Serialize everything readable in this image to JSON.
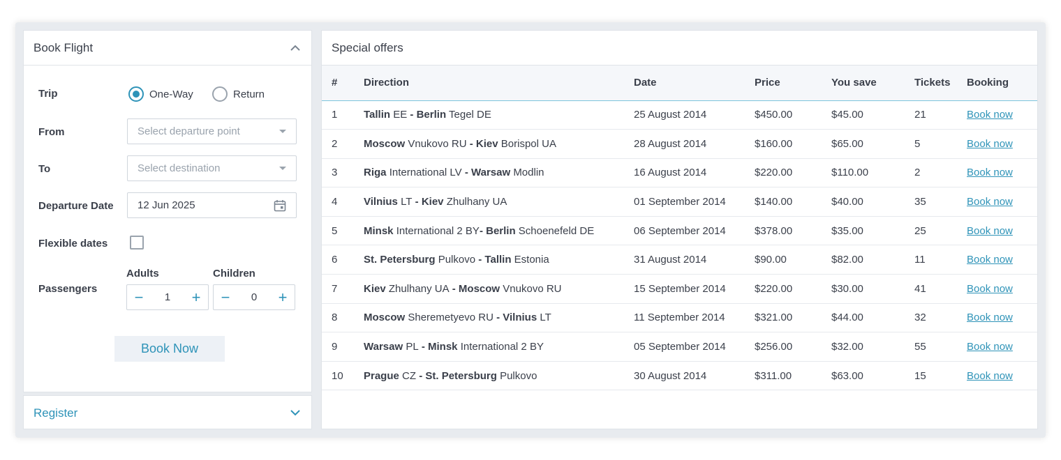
{
  "book_flight": {
    "title": "Book Flight",
    "trip_label": "Trip",
    "trip_options": [
      "One-Way",
      "Return"
    ],
    "trip_selected": "One-Way",
    "from_label": "From",
    "from_placeholder": "Select departure point",
    "to_label": "To",
    "to_placeholder": "Select destination",
    "departure_label": "Departure Date",
    "departure_value": "12 Jun 2025",
    "flexible_label": "Flexible dates",
    "flexible_checked": false,
    "passengers_label": "Passengers",
    "adults_label": "Adults",
    "adults_value": "1",
    "children_label": "Children",
    "children_value": "0",
    "minus": "−",
    "plus": "+",
    "submit_label": "Book Now"
  },
  "register": {
    "title": "Register"
  },
  "offers": {
    "title": "Special offers",
    "columns": [
      "#",
      "Direction",
      "Date",
      "Price",
      "You save",
      "Tickets",
      "Booking"
    ],
    "rows": [
      {
        "num": "1",
        "from_city": "Tallin",
        "from_rest": "EE",
        "to_city": "Berlin",
        "to_rest": "Tegel DE",
        "sep": " - ",
        "date": "25 August 2014",
        "price": "$450.00",
        "save": "$45.00",
        "tickets": "21",
        "booking": "Book now"
      },
      {
        "num": "2",
        "from_city": "Moscow",
        "from_rest": "Vnukovo RU",
        "to_city": "Kiev",
        "to_rest": "Borispol UA",
        "sep": " - ",
        "date": "28 August 2014",
        "price": "$160.00",
        "save": "$65.00",
        "tickets": "5",
        "booking": "Book now"
      },
      {
        "num": "3",
        "from_city": "Riga",
        "from_rest": "International LV",
        "to_city": "Warsaw",
        "to_rest": "Modlin",
        "sep": " - ",
        "date": "16 August 2014",
        "price": "$220.00",
        "save": "$110.00",
        "tickets": "2",
        "booking": "Book now"
      },
      {
        "num": "4",
        "from_city": "Vilnius",
        "from_rest": "LT",
        "to_city": "Kiev",
        "to_rest": "Zhulhany UA",
        "sep": " - ",
        "date": "01 September 2014",
        "price": "$140.00",
        "save": "$40.00",
        "tickets": "35",
        "booking": "Book now"
      },
      {
        "num": "5",
        "from_city": "Minsk",
        "from_rest": "International 2 BY",
        "to_city": "Berlin",
        "to_rest": "Schoenefeld DE",
        "sep": "- ",
        "date": "06 September 2014",
        "price": "$378.00",
        "save": "$35.00",
        "tickets": "25",
        "booking": "Book now"
      },
      {
        "num": "6",
        "from_city": "St. Petersburg",
        "from_rest": "Pulkovo",
        "to_city": "Tallin",
        "to_rest": "Estonia",
        "sep": " - ",
        "date": "31 August 2014",
        "price": "$90.00",
        "save": "$82.00",
        "tickets": "11",
        "booking": "Book now"
      },
      {
        "num": "7",
        "from_city": "Kiev",
        "from_rest": "Zhulhany UA",
        "to_city": "Moscow",
        "to_rest": "Vnukovo RU",
        "sep": " - ",
        "date": "15 September 2014",
        "price": "$220.00",
        "save": "$30.00",
        "tickets": "41",
        "booking": "Book now"
      },
      {
        "num": "8",
        "from_city": "Moscow",
        "from_rest": "Sheremetyevo RU",
        "to_city": "Vilnius",
        "to_rest": "LT",
        "sep": " - ",
        "date": "11 September 2014",
        "price": "$321.00",
        "save": "$44.00",
        "tickets": "32",
        "booking": "Book now"
      },
      {
        "num": "9",
        "from_city": "Warsaw",
        "from_rest": "PL",
        "to_city": "Minsk",
        "to_rest": "International 2 BY",
        "sep": " - ",
        "date": "05 September 2014",
        "price": "$256.00",
        "save": "$32.00",
        "tickets": "55",
        "booking": "Book now"
      },
      {
        "num": "10",
        "from_city": "Prague",
        "from_rest": "CZ",
        "to_city": "St. Petersburg",
        "to_rest": "Pulkovo",
        "sep": " - ",
        "date": "30 August 2014",
        "price": "$311.00",
        "save": "$63.00",
        "tickets": "15",
        "booking": "Book now"
      }
    ]
  },
  "colors": {
    "accent": "#2e93b8",
    "border": "#dfe3e8",
    "text": "#3a3f4a"
  }
}
